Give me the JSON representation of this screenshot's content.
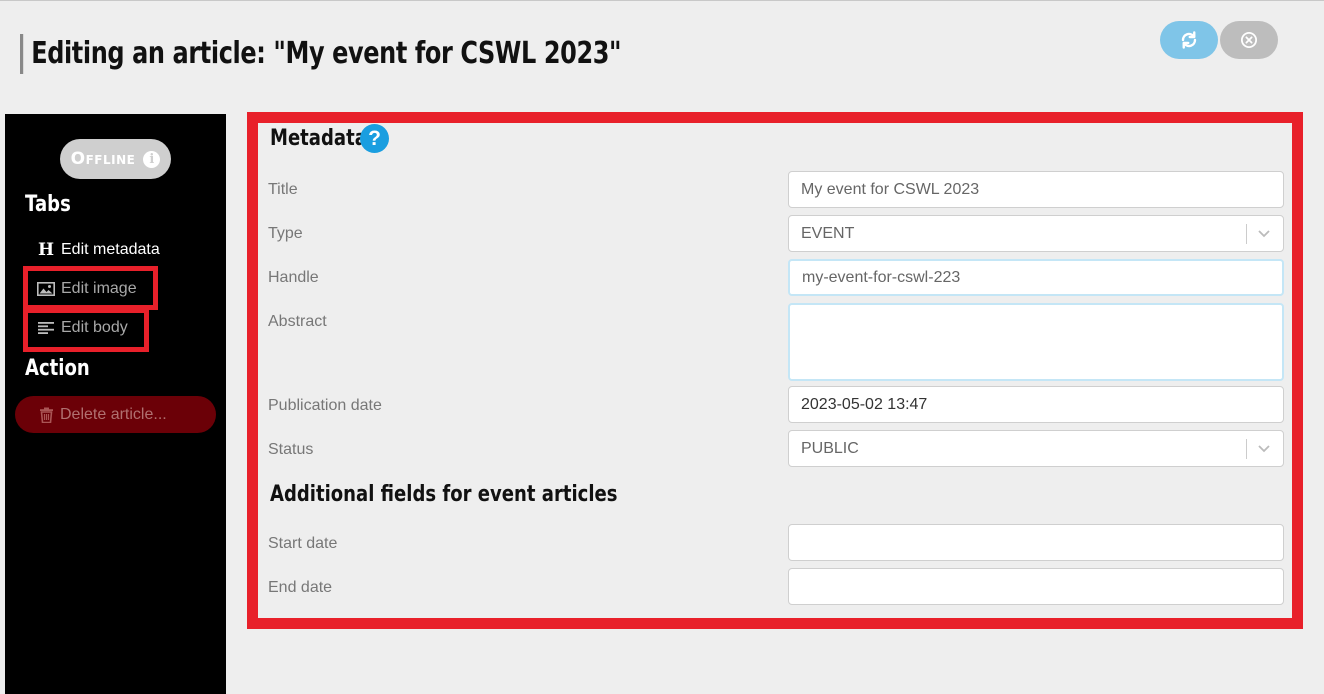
{
  "header": {
    "title": "Editing an article: \"My event for CSWL 2023\"",
    "refresh_icon": "refresh-icon",
    "close_icon": "close-circle-icon"
  },
  "sidebar": {
    "status_label": "Offline",
    "tabs_heading": "Tabs",
    "tabs": [
      {
        "label": "Edit metadata",
        "icon": "heading-icon",
        "active": true
      },
      {
        "label": "Edit image",
        "icon": "image-icon",
        "active": false
      },
      {
        "label": "Edit body",
        "icon": "text-align-left-icon",
        "active": false
      }
    ],
    "action_heading": "Action",
    "delete_label": "Delete article..."
  },
  "metadata": {
    "heading": "Metadata",
    "fields": {
      "title": {
        "label": "Title",
        "value": "My event for CSWL 2023"
      },
      "type": {
        "label": "Type",
        "value": "EVENT"
      },
      "handle": {
        "label": "Handle",
        "value": "my-event-for-cswl-223"
      },
      "abstract": {
        "label": "Abstract",
        "value": ""
      },
      "publication_date": {
        "label": "Publication date",
        "value": "2023-05-02 13:47"
      },
      "status": {
        "label": "Status",
        "value": "PUBLIC"
      }
    }
  },
  "event": {
    "heading": "Additional fields for event articles",
    "start_date": {
      "label": "Start date",
      "value": ""
    },
    "end_date": {
      "label": "End date",
      "value": ""
    }
  },
  "colors": {
    "highlight": "#e8202a",
    "refresh_button": "#7fc5e8",
    "close_button": "#bdbdbd",
    "help_icon": "#1a9ee0",
    "delete_button": "#6b0007"
  }
}
